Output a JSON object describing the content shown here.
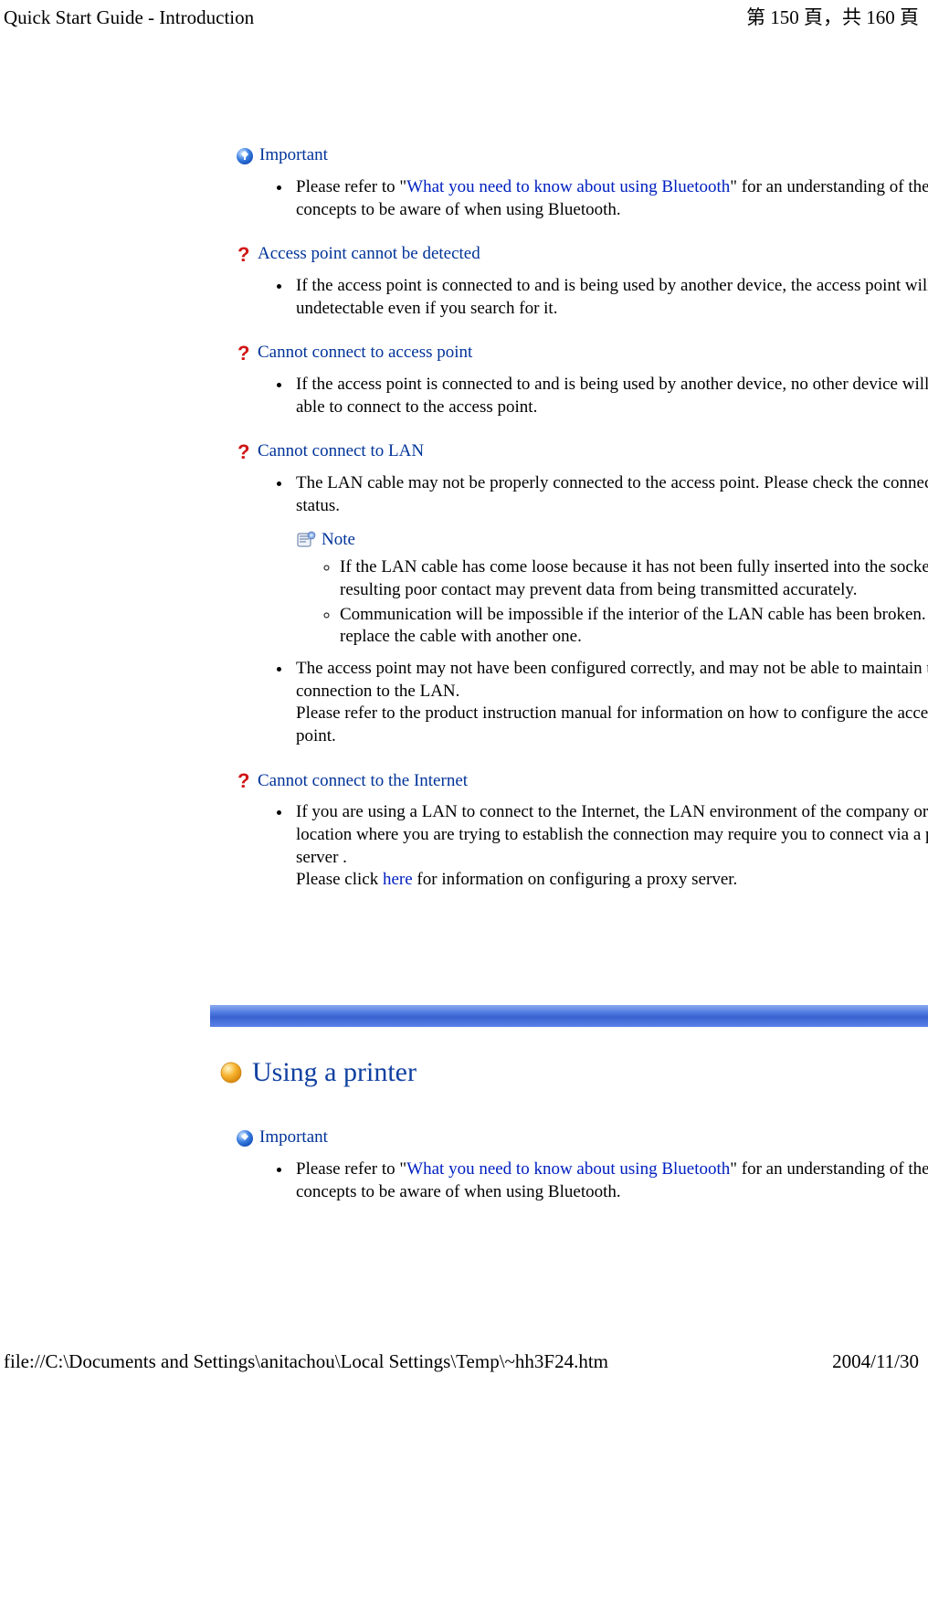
{
  "header": {
    "title": "Quick Start Guide - Introduction",
    "page_indicator": "第 150 頁，共 160 頁"
  },
  "important_block_1": {
    "label": "Important",
    "bullet_pre": "Please refer to \"",
    "bullet_link": "What you need to know about using Bluetooth",
    "bullet_post": "\" for an understanding of the basic concepts to be aware of when using Bluetooth."
  },
  "sections": [
    {
      "heading": "Access point cannot be detected",
      "bullets": [
        "If the access point is connected to and is being used by another device, the access point will be undetectable even if you search for it."
      ]
    },
    {
      "heading": "Cannot connect to access point",
      "bullets": [
        "If the access point is connected to and is being used by another device, no other device will be able to connect to the access point."
      ]
    },
    {
      "heading": "Cannot connect to LAN",
      "bullets_lan_1": "The LAN cable may not be properly connected to the access point. Please check the connection status.",
      "note_label": "Note",
      "note_sub": [
        "If the LAN cable has come loose because it has not been fully inserted into the socket, the resulting poor contact may prevent data from being transmitted accurately.",
        "Communication will be impossible if the interior of the LAN cable has been broken. Please replace the cable with another one."
      ],
      "bullets_lan_2_a": "The access point may not have been configured correctly, and may not be able to maintain the connection to the LAN.",
      "bullets_lan_2_b": "Please refer to the product instruction manual for information on how to configure the access point."
    },
    {
      "heading": "Cannot connect to the Internet",
      "internet_a": "If you are using a LAN to connect to the Internet, the LAN environment of the company or location where you are trying to establish the connection may require you to connect via a proxy server .",
      "internet_b_pre": "Please click ",
      "internet_link": "here",
      "internet_b_post": " for information on configuring a proxy server."
    }
  ],
  "section_title_2": "Using a printer",
  "important_block_2": {
    "label": "Important",
    "bullet_pre": "Please refer to \"",
    "bullet_link": "What you need to know about using Bluetooth",
    "bullet_post": "\" for an understanding of the basic concepts to be aware of when using Bluetooth."
  },
  "footer": {
    "path": "file://C:\\Documents and Settings\\anitachou\\Local Settings\\Temp\\~hh3F24.htm",
    "date": "2004/11/30"
  }
}
